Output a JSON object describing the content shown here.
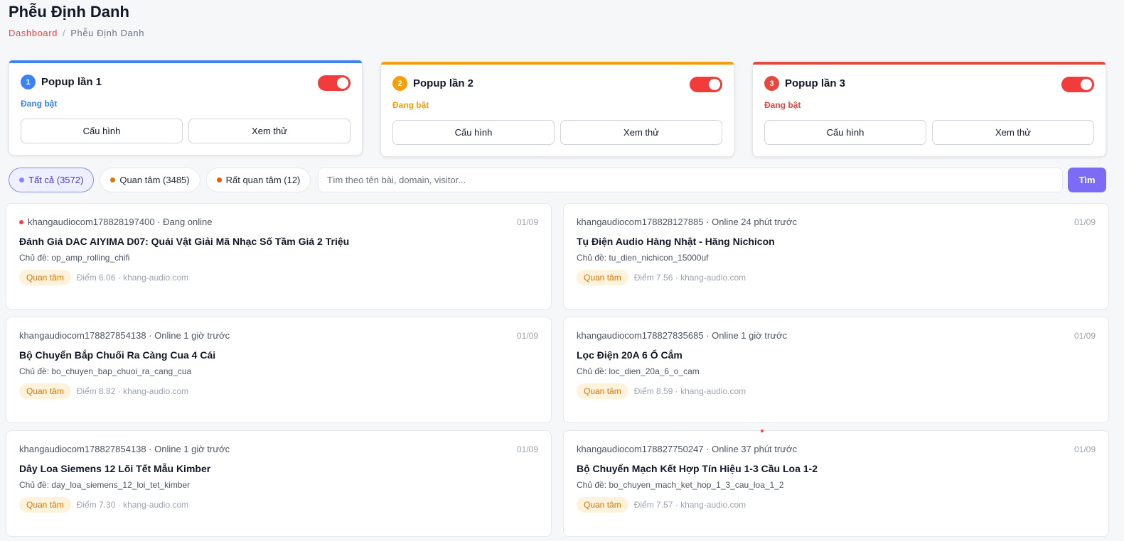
{
  "header": {
    "title": "Phễu Định Danh",
    "breadcrumb": {
      "link": "Dashboard",
      "separator": "/",
      "current": "Phễu Định Danh"
    }
  },
  "popups": [
    {
      "number": "1",
      "name": "Popup lần 1",
      "status": "Đang bật",
      "enabled": true,
      "config_label": "Cấu hình",
      "preview_label": "Xem thử",
      "accent": "#3b82f6"
    },
    {
      "number": "2",
      "name": "Popup lần 2",
      "status": "Đang bật",
      "enabled": true,
      "config_label": "Cấu hình",
      "preview_label": "Xem thử",
      "accent": "#f59e0b"
    },
    {
      "number": "3",
      "name": "Popup lần 3",
      "status": "Đang bật",
      "enabled": true,
      "config_label": "Cấu hình",
      "preview_label": "Xem thử",
      "accent": "#e5483f"
    }
  ],
  "toggle_color": "#f23b3b",
  "filters": [
    {
      "label": "Tất cả (3572)",
      "dot_color": "#818cf8",
      "active": true
    },
    {
      "label": "Quan tâm (3485)",
      "dot_color": "#d97706",
      "active": false
    },
    {
      "label": "Rất quan tâm (12)",
      "dot_color": "#ea580c",
      "active": false
    }
  ],
  "search": {
    "placeholder": "Tìm theo tên bài, domain, visitor...",
    "value": "",
    "button_label": "Tìm"
  },
  "visitors": [
    {
      "visitor": "khangaudiocom178828197400",
      "presence": "Đang online",
      "online": true,
      "date": "01/09",
      "title": "Đánh Giá DAC AIYIMA D07: Quái Vật Giải Mã Nhạc Số Tầm Giá 2 Triệu",
      "topic": "Chủ đề: op_amp_rolling_chifi",
      "tag": "Quan tâm",
      "score": "Điểm 6.06",
      "domain": "khang-audio.com"
    },
    {
      "visitor": "khangaudiocom178828127885",
      "presence": "Online 24 phút trước",
      "online": false,
      "date": "01/09",
      "title": "Tụ Điện Audio Hàng Nhật - Hãng Nichicon",
      "topic": "Chủ đề: tu_dien_nichicon_15000uf",
      "tag": "Quan tâm",
      "score": "Điểm 7.56",
      "domain": "khang-audio.com"
    },
    {
      "visitor": "khangaudiocom178827854138",
      "presence": "Online 1 giờ trước",
      "online": false,
      "date": "01/09",
      "title": "Bộ Chuyển Bắp Chuối Ra Càng Cua 4 Cái",
      "topic": "Chủ đề: bo_chuyen_bap_chuoi_ra_cang_cua",
      "tag": "Quan tâm",
      "score": "Điểm 8.82",
      "domain": "khang-audio.com"
    },
    {
      "visitor": "khangaudiocom178827835685",
      "presence": "Online 1 giờ trước",
      "online": false,
      "date": "01/09",
      "title": "Lọc Điện 20A 6 Ổ Cắm",
      "topic": "Chủ đề: loc_dien_20a_6_o_cam",
      "tag": "Quan tâm",
      "score": "Điểm 8.59",
      "domain": "khang-audio.com"
    },
    {
      "visitor": "khangaudiocom178827854138",
      "presence": "Online 1 giờ trước",
      "online": false,
      "date": "01/09",
      "title": "Dây Loa Siemens 12 Lõi Tết Mẫu Kimber",
      "topic": "Chủ đề: day_loa_siemens_12_loi_tet_kimber",
      "tag": "Quan tâm",
      "score": "Điểm 7.30",
      "domain": "khang-audio.com"
    },
    {
      "visitor": "khangaudiocom178827750247",
      "presence": "Online 37 phút trước",
      "online": false,
      "date": "01/09",
      "title": "Bộ Chuyển Mạch Kết Hợp Tín Hiệu 1-3 Cầu Loa 1-2",
      "topic": "Chủ đề: bo_chuyen_mach_ket_hop_1_3_cau_loa_1_2",
      "tag": "Quan tâm",
      "score": "Điểm 7.57",
      "domain": "khang-audio.com"
    }
  ]
}
